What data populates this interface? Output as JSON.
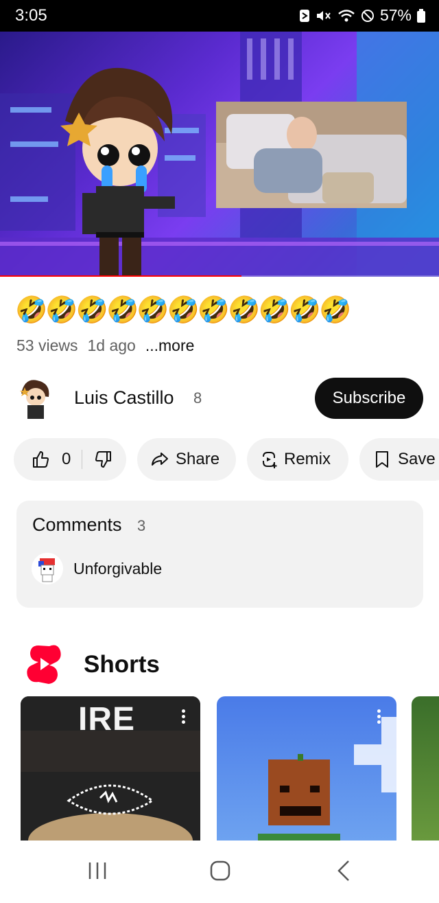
{
  "status_bar": {
    "time": "3:05",
    "battery": "57%"
  },
  "video": {
    "progress": 0.55
  },
  "title": "🤣🤣🤣🤣🤣🤣🤣🤣🤣🤣🤣",
  "meta": {
    "views": "53 views",
    "age": "1d ago",
    "more": "...more"
  },
  "channel": {
    "name": "Luis Castillo",
    "subscriber_count": "8",
    "subscribe_label": "Subscribe"
  },
  "actions": {
    "like_count": "0",
    "share_label": "Share",
    "remix_label": "Remix",
    "save_label": "Save"
  },
  "comments": {
    "title": "Comments",
    "count": "3",
    "first_comment_author": "Unforgivable"
  },
  "shorts": {
    "title": "Shorts",
    "cards": [
      {
        "overlay_text": "IRE"
      },
      {
        "overlay_text": ""
      }
    ]
  },
  "colors": {
    "accent_red": "#ff0000",
    "dark": "#0f0f0f",
    "pill_bg": "#f2f2f2",
    "meta_gray": "#606060"
  }
}
